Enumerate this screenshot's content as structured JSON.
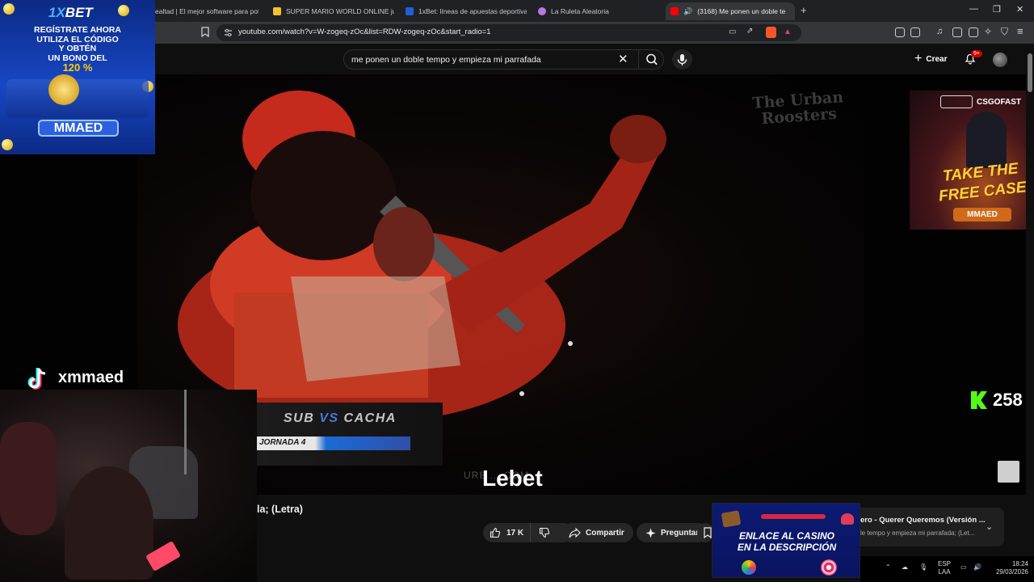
{
  "browser": {
    "tabs": [
      {
        "label": "ealtad | El mejor software para pote",
        "favicon_color": "#6aa84f"
      },
      {
        "label": "SUPER MARIO WORLD ONLINE jueg",
        "favicon_color": "#f1c232"
      },
      {
        "label": "1xBet: líneas de apuestas deportivas",
        "favicon_color": "#1f5fd6"
      },
      {
        "label": "La Ruleta Aleatoria",
        "favicon_color": "#b47ae0"
      },
      {
        "label": "(3168) Me ponen un doble te",
        "favicon_color": "#ff0000",
        "active": true
      }
    ],
    "url": "youtube.com/watch?v=W-zogeq-zOc&list=RDW-zogeq-zOc&start_radio=1"
  },
  "youtube": {
    "search_query": "me ponen un doble tempo y empieza mi parrafada",
    "create_label": "Crear",
    "notification_count": "9+",
    "video_title": "la; (Letra)",
    "likes": "17 K",
    "share_label": "Compartir",
    "ask_label": "Preguntar",
    "mix": {
      "line1": "ero - Querer Queremos (Versión ...",
      "line2": "le tempo y empieza mi parrafada; (Let..."
    }
  },
  "video": {
    "scoreboard": {
      "left": "SUB",
      "vs": "VS",
      "right": "CACHA",
      "round": "JORNADA 4"
    },
    "site_watermark": "URB ... COM",
    "watermark_text": "The Urban Roosters",
    "lyric": "Lebet"
  },
  "overlays": {
    "ad_1xbet": {
      "brand_prefix": "1X",
      "brand": "BET",
      "lines": [
        "REGÍSTRATE AHORA",
        "UTILIZA EL CÓDIGO",
        "Y OBTÉN",
        "UN BONO DEL"
      ],
      "percent": "120 %",
      "code": "MMAED"
    },
    "ad_cs": {
      "logo": "CSGOFAST",
      "headline": "TAKE THE FREE CASE",
      "code": "MMAED"
    },
    "tiktok_handle": "xmmaed",
    "kick_viewers": "258",
    "casino_ad": {
      "line1": "ENLACE AL CASINO",
      "line2": "EN LA DESCRIPCIÓN"
    }
  },
  "tray": {
    "lang1": "ESP",
    "lang2": "LAA",
    "time": "18:24",
    "date": "29/03/2026"
  }
}
